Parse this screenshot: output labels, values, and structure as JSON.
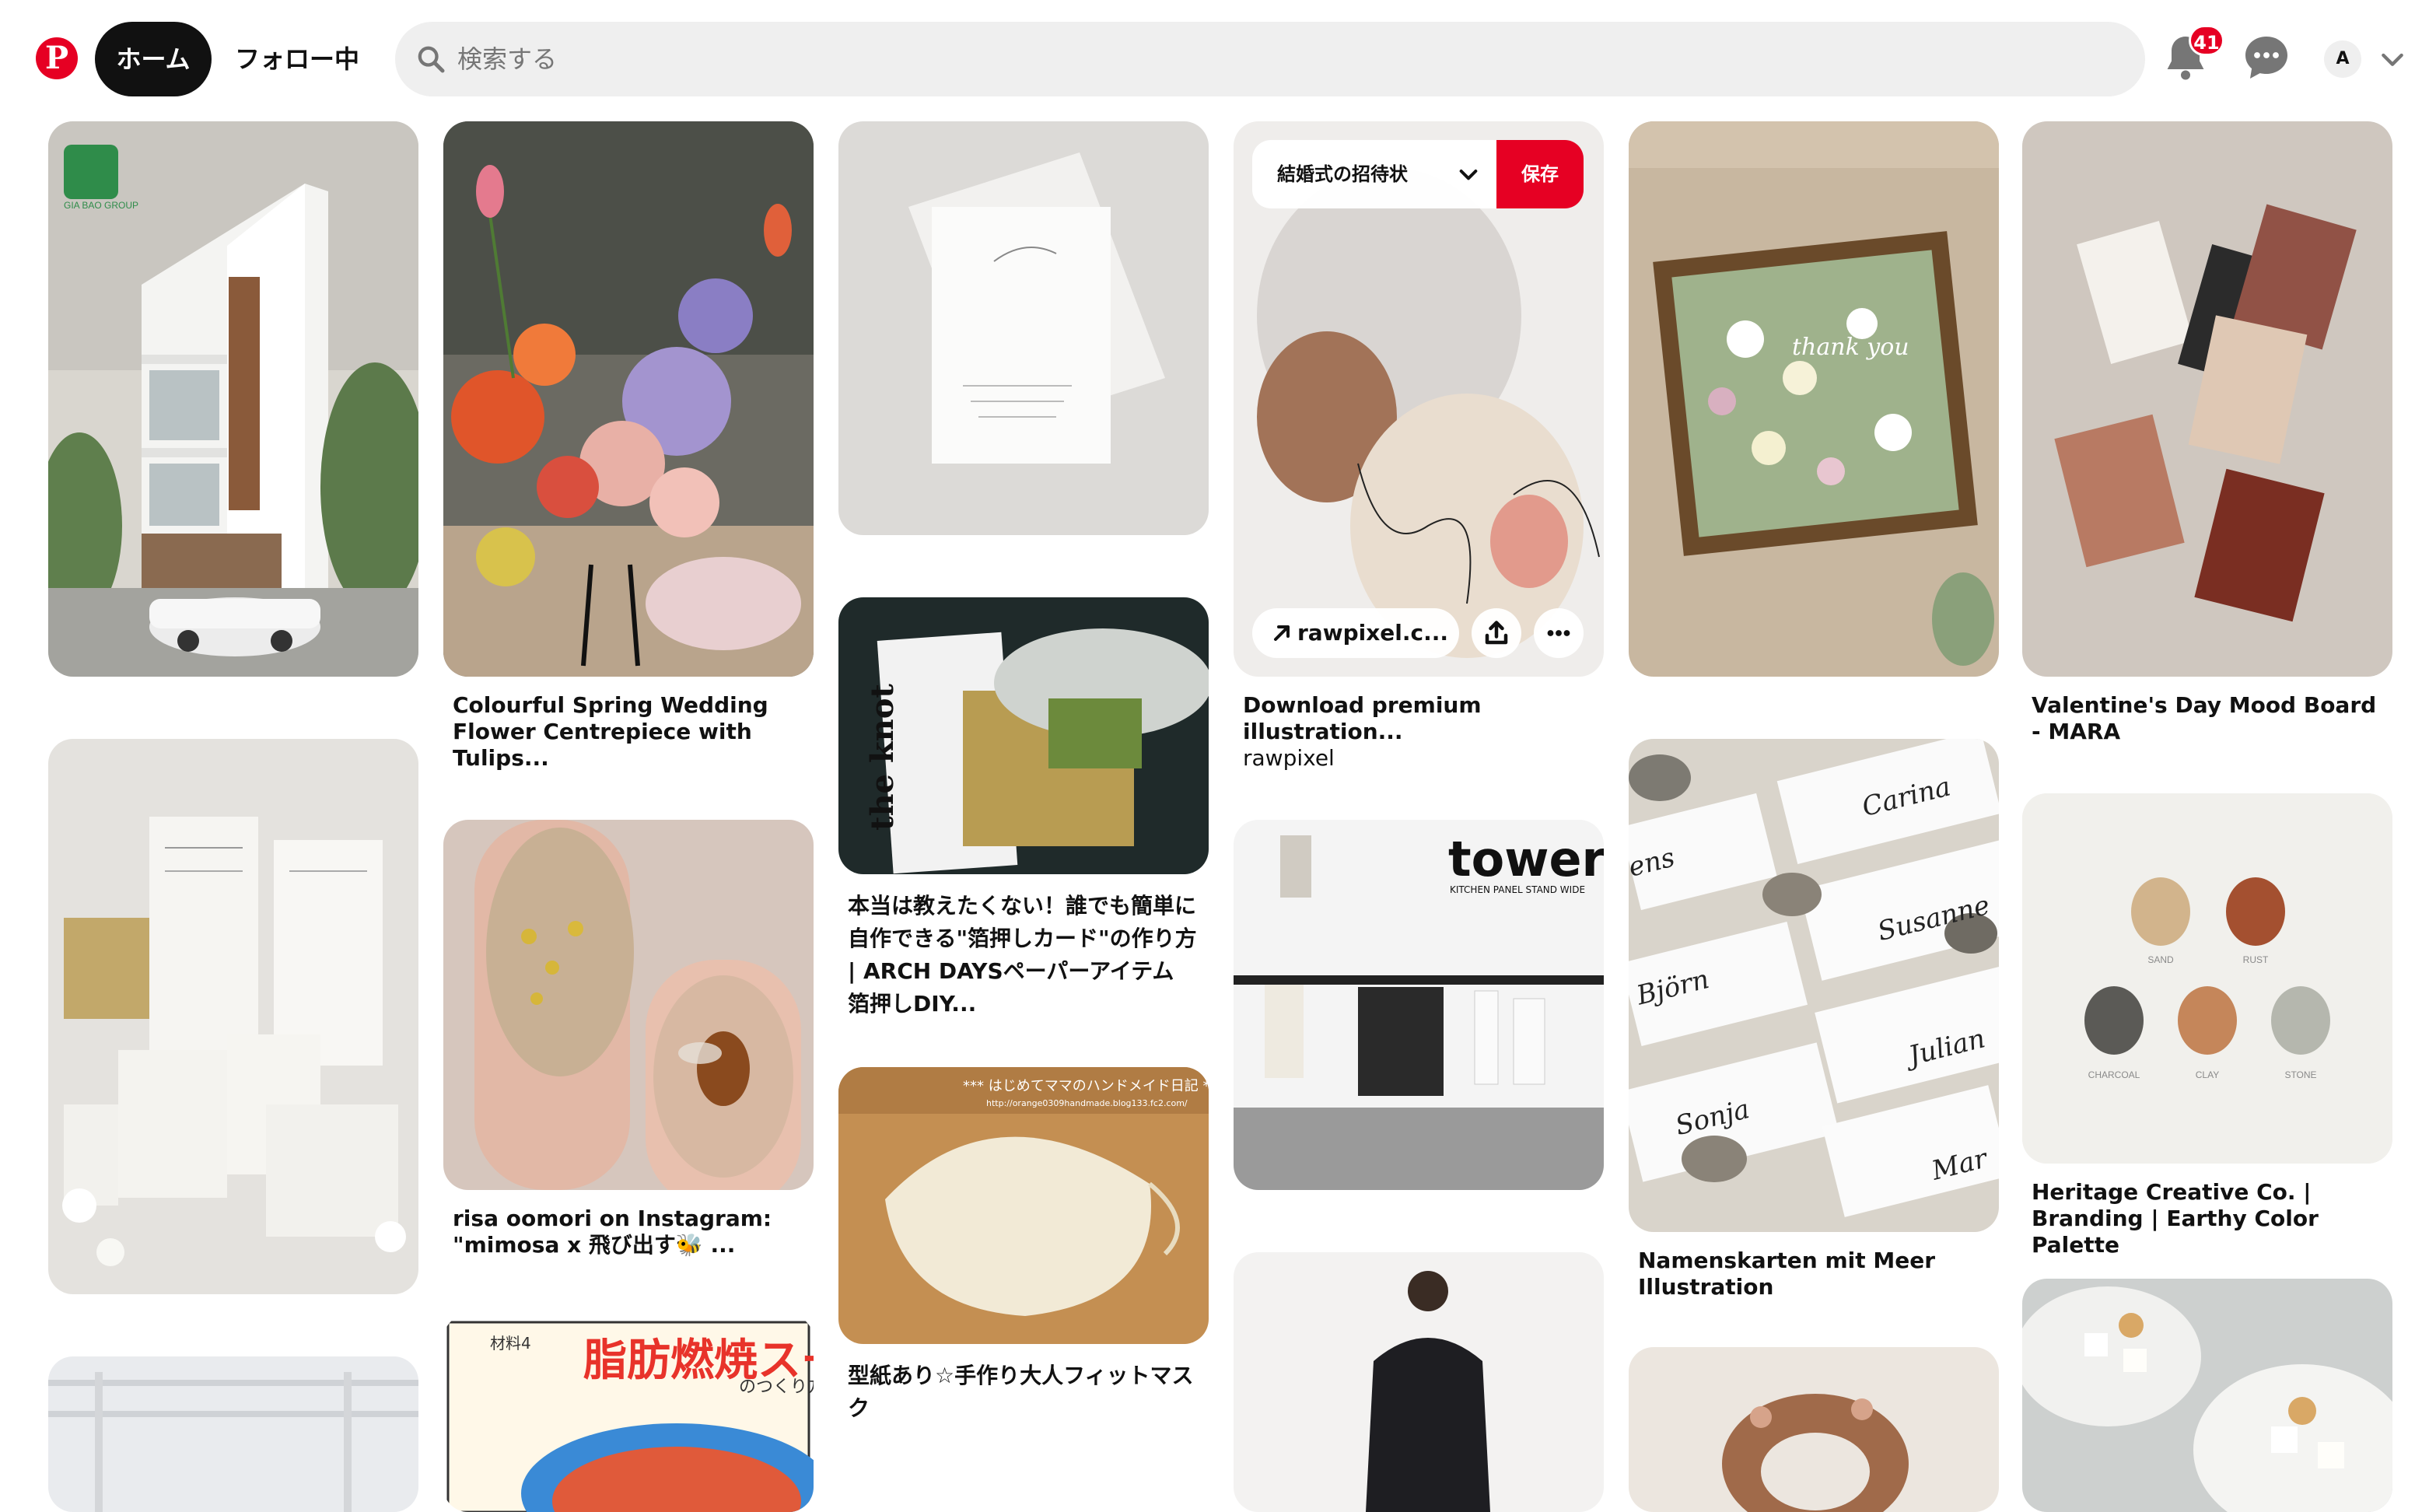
{
  "nav": {
    "home": "ホーム",
    "following": "フォロー中"
  },
  "search": {
    "placeholder": "検索する"
  },
  "notifications": {
    "count": "41"
  },
  "profile": {
    "initial": "A"
  },
  "colors": {
    "brand": "#e60023",
    "nav_active_bg": "#111111",
    "search_bg": "#efefef"
  },
  "pins": {
    "gia_bao": {
      "logo_text": "GIA BAO GROUP"
    },
    "wedding_flowers": {
      "title": "Colourful Spring Wedding Flower Centrepiece with Tulips..."
    },
    "watercolor": {
      "board": "結婚式の招待状",
      "save": "保存",
      "link": "rawpixel.c...",
      "title": "Download premium illustration...",
      "source": "rawpixel"
    },
    "valentine": {
      "title": "Valentine's Day Mood Board - MARA"
    },
    "foil_card": {
      "title": "本当は教えたくない！誰でも簡単に自作できる\"箔押しカード\"の作り方 | ARCH DAYSペーパーアイテム 箔押しDIY...",
      "magazine": "the knot"
    },
    "nails": {
      "title": "risa oomori on Instagram: \"mimosa x 飛び出す🐝 ..."
    },
    "tower": {
      "brand": "tower",
      "tagline": "KITCHEN PANEL STAND WIDE"
    },
    "place_cards": {
      "title": "Namenskarten mit Meer Illustration",
      "names": [
        "Carina",
        "Susanne",
        "Björn",
        "Julian",
        "Sonja",
        "Mar",
        "ens"
      ]
    },
    "palette": {
      "title": "Heritage Creative Co. | Branding | Earthy Color Palette",
      "swatches": [
        "SAND",
        "RUST",
        "CHARCOAL",
        "CLAY",
        "STONE"
      ]
    },
    "mask": {
      "title": "型紙あり☆手作り大人フィットマスク",
      "banner": "*** はじめてママのハンドメイド日記 ***",
      "url": "http://orange0309handmade.blog133.fc2.com/"
    },
    "soup": {
      "banner": "脂肪燃焼スープ",
      "sub": "のつくり方",
      "label": "材料4"
    },
    "flowerbox": {
      "overlay": "thank you"
    }
  }
}
